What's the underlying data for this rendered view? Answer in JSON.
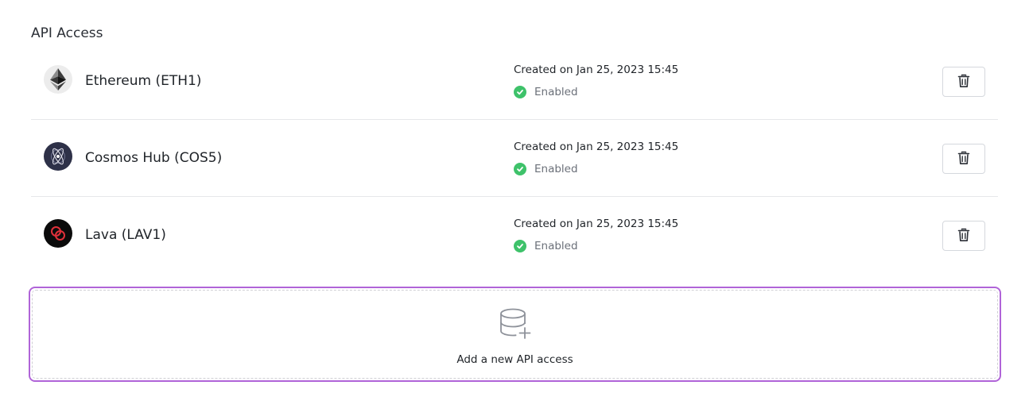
{
  "section": {
    "title": "API Access"
  },
  "apis": [
    {
      "name": "Ethereum (ETH1)",
      "icon": "ethereum-logo-icon",
      "created": "Created on Jan 25, 2023 15:45",
      "status": "Enabled"
    },
    {
      "name": "Cosmos Hub (COS5)",
      "icon": "cosmos-logo-icon",
      "created": "Created on Jan 25, 2023 15:45",
      "status": "Enabled"
    },
    {
      "name": "Lava (LAV1)",
      "icon": "lava-logo-icon",
      "created": "Created on Jan 25, 2023 15:45",
      "status": "Enabled"
    }
  ],
  "add_card": {
    "label": "Add a new API access",
    "icon": "database-plus-icon"
  },
  "colors": {
    "accent_border": "#b064d8",
    "status_enabled": "#3ec26a"
  }
}
